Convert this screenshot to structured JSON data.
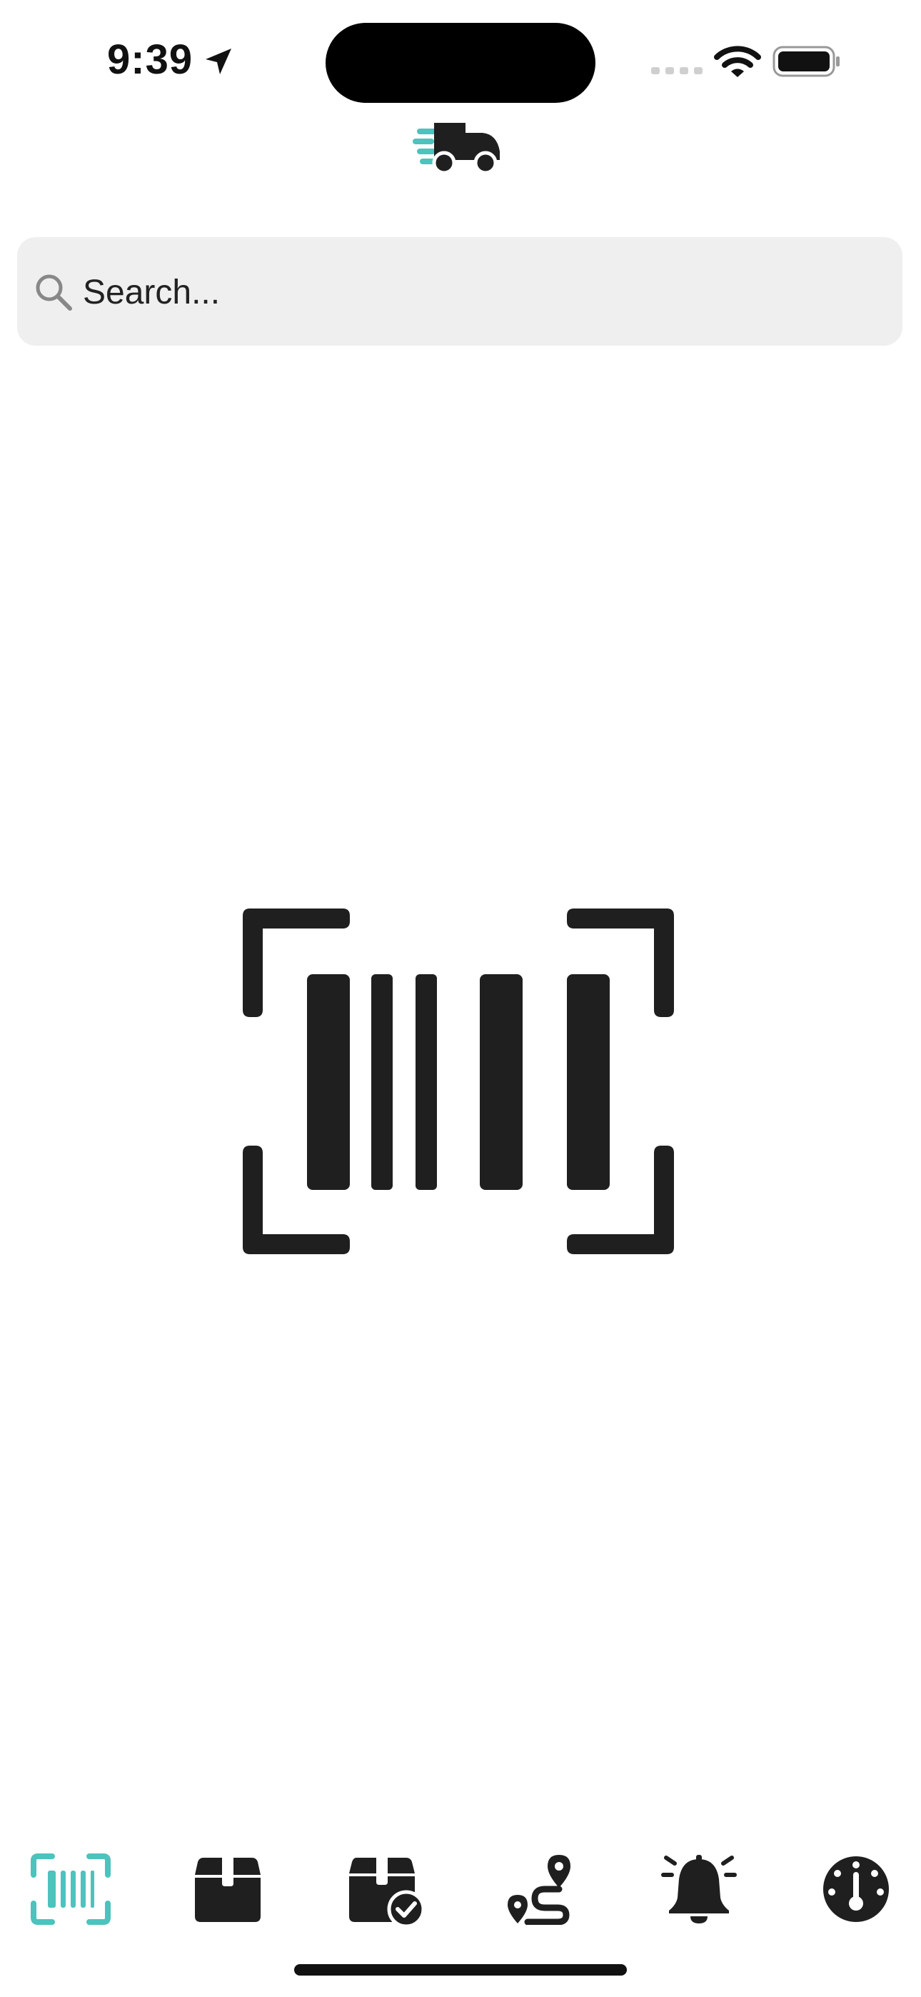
{
  "status_bar": {
    "time": "9:39",
    "icons": [
      "location-arrow-icon",
      "cellular-signal-icon",
      "wifi-icon",
      "battery-icon"
    ]
  },
  "header": {
    "logo_icon": "delivery-truck-icon"
  },
  "search": {
    "placeholder": "Search...",
    "value": ""
  },
  "main": {
    "center_icon": "barcode-scan-icon"
  },
  "tab_bar": {
    "active_index": 0,
    "tabs": [
      {
        "icon": "barcode-scan-icon"
      },
      {
        "icon": "package-icon"
      },
      {
        "icon": "package-check-icon"
      },
      {
        "icon": "route-icon"
      },
      {
        "icon": "alert-bell-icon"
      },
      {
        "icon": "gauge-icon"
      }
    ]
  },
  "colors": {
    "accent": "#4cc3bd",
    "icon_dark": "#1f1f1f",
    "search_bg": "#efefef",
    "background": "#ffffff"
  }
}
